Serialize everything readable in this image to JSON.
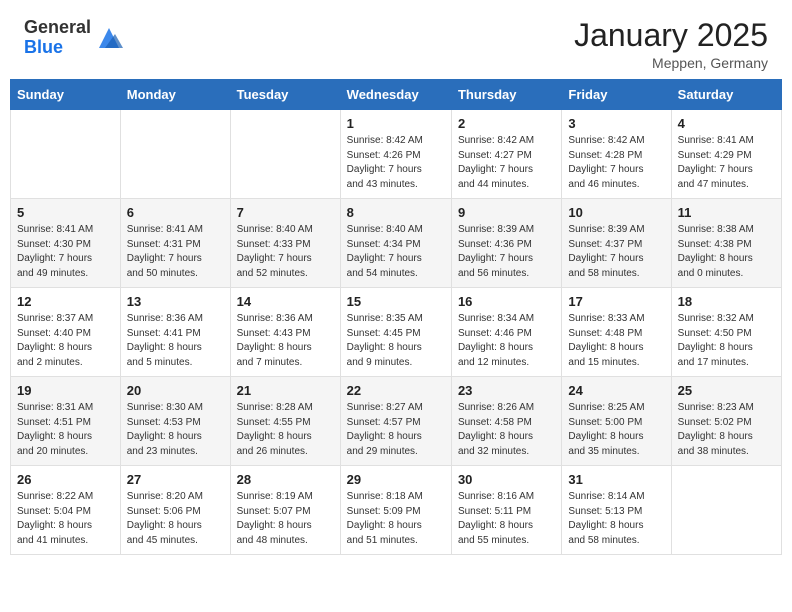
{
  "header": {
    "logo_general": "General",
    "logo_blue": "Blue",
    "month_title": "January 2025",
    "location": "Meppen, Germany"
  },
  "days_of_week": [
    "Sunday",
    "Monday",
    "Tuesday",
    "Wednesday",
    "Thursday",
    "Friday",
    "Saturday"
  ],
  "weeks": [
    [
      {
        "day": "",
        "info": ""
      },
      {
        "day": "",
        "info": ""
      },
      {
        "day": "",
        "info": ""
      },
      {
        "day": "1",
        "info": "Sunrise: 8:42 AM\nSunset: 4:26 PM\nDaylight: 7 hours\nand 43 minutes."
      },
      {
        "day": "2",
        "info": "Sunrise: 8:42 AM\nSunset: 4:27 PM\nDaylight: 7 hours\nand 44 minutes."
      },
      {
        "day": "3",
        "info": "Sunrise: 8:42 AM\nSunset: 4:28 PM\nDaylight: 7 hours\nand 46 minutes."
      },
      {
        "day": "4",
        "info": "Sunrise: 8:41 AM\nSunset: 4:29 PM\nDaylight: 7 hours\nand 47 minutes."
      }
    ],
    [
      {
        "day": "5",
        "info": "Sunrise: 8:41 AM\nSunset: 4:30 PM\nDaylight: 7 hours\nand 49 minutes."
      },
      {
        "day": "6",
        "info": "Sunrise: 8:41 AM\nSunset: 4:31 PM\nDaylight: 7 hours\nand 50 minutes."
      },
      {
        "day": "7",
        "info": "Sunrise: 8:40 AM\nSunset: 4:33 PM\nDaylight: 7 hours\nand 52 minutes."
      },
      {
        "day": "8",
        "info": "Sunrise: 8:40 AM\nSunset: 4:34 PM\nDaylight: 7 hours\nand 54 minutes."
      },
      {
        "day": "9",
        "info": "Sunrise: 8:39 AM\nSunset: 4:36 PM\nDaylight: 7 hours\nand 56 minutes."
      },
      {
        "day": "10",
        "info": "Sunrise: 8:39 AM\nSunset: 4:37 PM\nDaylight: 7 hours\nand 58 minutes."
      },
      {
        "day": "11",
        "info": "Sunrise: 8:38 AM\nSunset: 4:38 PM\nDaylight: 8 hours\nand 0 minutes."
      }
    ],
    [
      {
        "day": "12",
        "info": "Sunrise: 8:37 AM\nSunset: 4:40 PM\nDaylight: 8 hours\nand 2 minutes."
      },
      {
        "day": "13",
        "info": "Sunrise: 8:36 AM\nSunset: 4:41 PM\nDaylight: 8 hours\nand 5 minutes."
      },
      {
        "day": "14",
        "info": "Sunrise: 8:36 AM\nSunset: 4:43 PM\nDaylight: 8 hours\nand 7 minutes."
      },
      {
        "day": "15",
        "info": "Sunrise: 8:35 AM\nSunset: 4:45 PM\nDaylight: 8 hours\nand 9 minutes."
      },
      {
        "day": "16",
        "info": "Sunrise: 8:34 AM\nSunset: 4:46 PM\nDaylight: 8 hours\nand 12 minutes."
      },
      {
        "day": "17",
        "info": "Sunrise: 8:33 AM\nSunset: 4:48 PM\nDaylight: 8 hours\nand 15 minutes."
      },
      {
        "day": "18",
        "info": "Sunrise: 8:32 AM\nSunset: 4:50 PM\nDaylight: 8 hours\nand 17 minutes."
      }
    ],
    [
      {
        "day": "19",
        "info": "Sunrise: 8:31 AM\nSunset: 4:51 PM\nDaylight: 8 hours\nand 20 minutes."
      },
      {
        "day": "20",
        "info": "Sunrise: 8:30 AM\nSunset: 4:53 PM\nDaylight: 8 hours\nand 23 minutes."
      },
      {
        "day": "21",
        "info": "Sunrise: 8:28 AM\nSunset: 4:55 PM\nDaylight: 8 hours\nand 26 minutes."
      },
      {
        "day": "22",
        "info": "Sunrise: 8:27 AM\nSunset: 4:57 PM\nDaylight: 8 hours\nand 29 minutes."
      },
      {
        "day": "23",
        "info": "Sunrise: 8:26 AM\nSunset: 4:58 PM\nDaylight: 8 hours\nand 32 minutes."
      },
      {
        "day": "24",
        "info": "Sunrise: 8:25 AM\nSunset: 5:00 PM\nDaylight: 8 hours\nand 35 minutes."
      },
      {
        "day": "25",
        "info": "Sunrise: 8:23 AM\nSunset: 5:02 PM\nDaylight: 8 hours\nand 38 minutes."
      }
    ],
    [
      {
        "day": "26",
        "info": "Sunrise: 8:22 AM\nSunset: 5:04 PM\nDaylight: 8 hours\nand 41 minutes."
      },
      {
        "day": "27",
        "info": "Sunrise: 8:20 AM\nSunset: 5:06 PM\nDaylight: 8 hours\nand 45 minutes."
      },
      {
        "day": "28",
        "info": "Sunrise: 8:19 AM\nSunset: 5:07 PM\nDaylight: 8 hours\nand 48 minutes."
      },
      {
        "day": "29",
        "info": "Sunrise: 8:18 AM\nSunset: 5:09 PM\nDaylight: 8 hours\nand 51 minutes."
      },
      {
        "day": "30",
        "info": "Sunrise: 8:16 AM\nSunset: 5:11 PM\nDaylight: 8 hours\nand 55 minutes."
      },
      {
        "day": "31",
        "info": "Sunrise: 8:14 AM\nSunset: 5:13 PM\nDaylight: 8 hours\nand 58 minutes."
      },
      {
        "day": "",
        "info": ""
      }
    ]
  ]
}
